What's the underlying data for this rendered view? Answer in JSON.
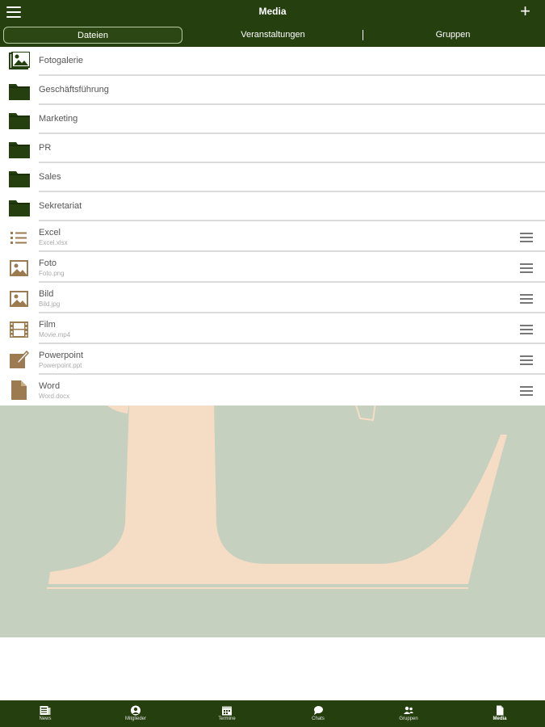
{
  "header": {
    "title": "Media"
  },
  "tabs": [
    {
      "label": "Dateien",
      "active": true
    },
    {
      "label": "Veranstaltungen",
      "active": false
    },
    {
      "label": "Gruppen",
      "active": false
    }
  ],
  "folders": [
    {
      "label": "Fotogalerie",
      "icon": "photo-gallery-icon"
    },
    {
      "label": "Geschäftsführung",
      "icon": "folder-icon"
    },
    {
      "label": "Marketing",
      "icon": "folder-icon"
    },
    {
      "label": "PR",
      "icon": "folder-icon"
    },
    {
      "label": "Sales",
      "icon": "folder-icon"
    },
    {
      "label": "Sekretariat",
      "icon": "folder-icon"
    }
  ],
  "files": [
    {
      "label": "Excel",
      "filename": "Excel.xlsx",
      "icon": "list-icon"
    },
    {
      "label": "Foto",
      "filename": "Foto.png",
      "icon": "image-icon"
    },
    {
      "label": "Bild",
      "filename": "Bild.jpg",
      "icon": "image-icon"
    },
    {
      "label": "Film",
      "filename": "Movie.mp4",
      "icon": "film-icon"
    },
    {
      "label": "Powerpoint",
      "filename": "Powerpoint.ppt",
      "icon": "edit-icon"
    },
    {
      "label": "Word",
      "filename": "Word.docx",
      "icon": "document-icon"
    }
  ],
  "bottom_nav": [
    {
      "label": "News",
      "icon": "news-icon",
      "active": false
    },
    {
      "label": "Mitglieder",
      "icon": "member-icon",
      "active": false
    },
    {
      "label": "Termine",
      "icon": "calendar-icon",
      "active": false
    },
    {
      "label": "Chats",
      "icon": "chat-icon",
      "active": false
    },
    {
      "label": "Gruppen",
      "icon": "group-icon",
      "active": false
    },
    {
      "label": "Media",
      "icon": "media-file-icon",
      "active": true
    }
  ],
  "colors": {
    "brand_green": "#253f0f",
    "file_icon_brown": "#9b7b4f",
    "background_tint": "#c6d0bf",
    "watermark_letter": "#f5dcc5"
  }
}
